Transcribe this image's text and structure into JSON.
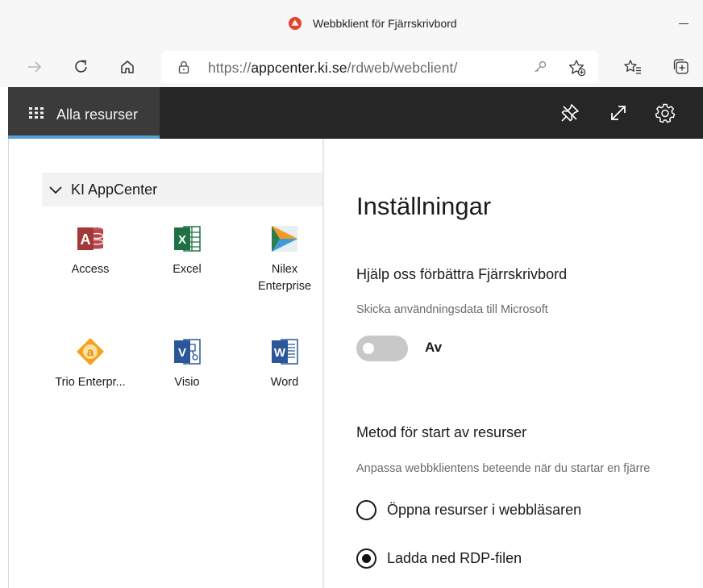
{
  "window": {
    "title": "Webbklient för Fjärrskrivbord"
  },
  "browser": {
    "url_prefix": "https://",
    "url_host": "appcenter.ki.se",
    "url_path": "/rdweb/webclient/"
  },
  "header": {
    "all_resources_label": "Alla resurser"
  },
  "sidebar": {
    "group_name": "KI AppCenter",
    "apps": [
      {
        "name": "Access"
      },
      {
        "name": "Excel"
      },
      {
        "name": "Nilex\nEnterprise"
      },
      {
        "name": "Trio Enterpr..."
      },
      {
        "name": "Visio"
      },
      {
        "name": "Word"
      }
    ]
  },
  "settings": {
    "title": "Inställningar",
    "telemetry": {
      "title": "Hjälp oss förbättra Fjärrskrivbord",
      "description": "Skicka användningsdata till Microsoft",
      "toggle_label": "Av",
      "enabled": false
    },
    "launch": {
      "title": "Metod för start av resurser",
      "description": "Anpassa webbklientens beteende när du startar en fjärre",
      "option_browser": "Öppna resurser i webbläsaren",
      "option_rdp": "Ladda ned RDP-filen",
      "selected": "rdp"
    }
  },
  "colors": {
    "header_bg": "#262626",
    "tab_active_bg": "#3b3b3b",
    "tab_accent": "#5aa0d8",
    "toggle_off": "#c8c8c8",
    "access": "#a4373a",
    "excel": "#1e7145",
    "visio": "#2b579a",
    "word": "#2b579a",
    "trio": "#f7a21b"
  }
}
